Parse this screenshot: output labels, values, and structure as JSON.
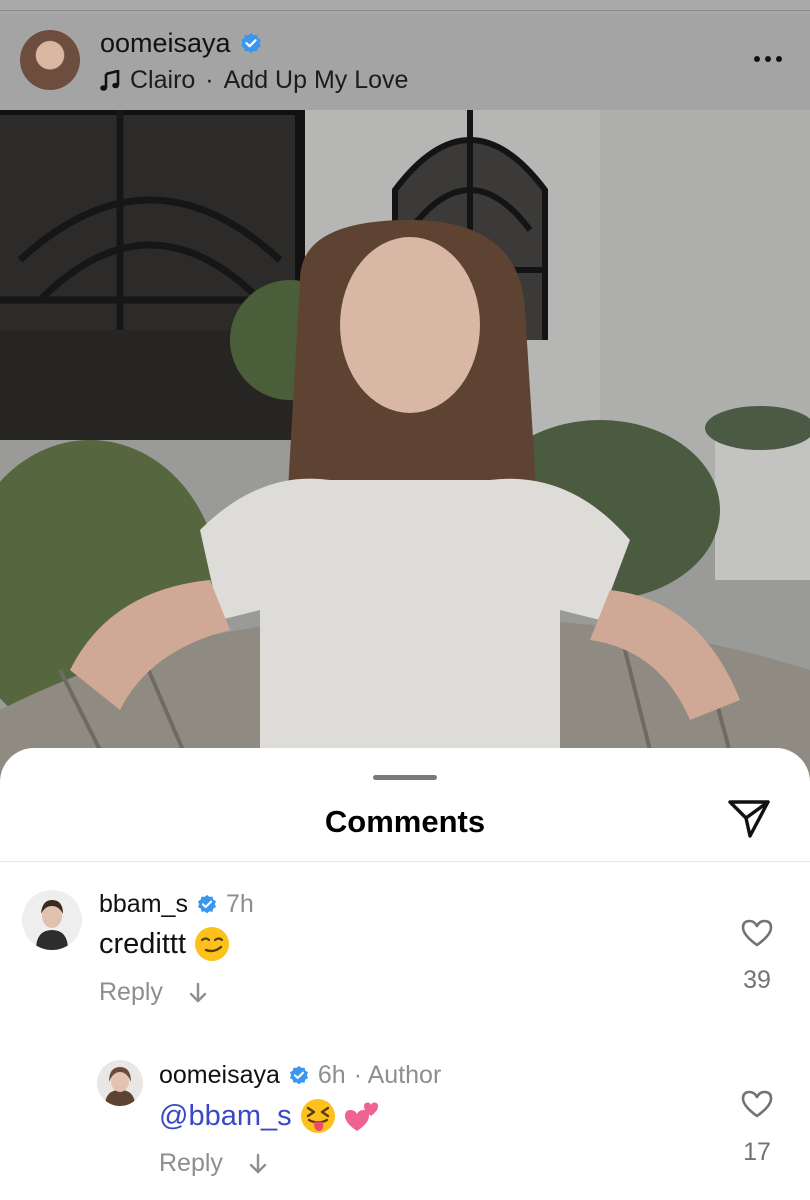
{
  "post": {
    "username": "oomeisaya",
    "music_artist": "Clairo",
    "music_separator": "·",
    "music_title": "Add Up My Love",
    "icons": {
      "music": "music-note-icon",
      "more": "more-options-icon",
      "verified": "verified-badge-icon"
    }
  },
  "sheet": {
    "title": "Comments",
    "share_icon": "send-icon"
  },
  "comments": [
    {
      "username": "bbam_s",
      "verified": true,
      "time": "7h",
      "text": "credittt",
      "emoji": "smirking-face",
      "reply_label": "Reply",
      "likes": "39"
    },
    {
      "username": "oomeisaya",
      "verified": true,
      "time": "6h",
      "author_label": "· Author",
      "mention": "@bbam_s",
      "emoji": [
        "squinting-face-with-tongue",
        "two-hearts"
      ],
      "reply_label": "Reply",
      "likes": "17"
    }
  ],
  "colors": {
    "verified": "#3897f0",
    "mention": "#3a48c8",
    "muted": "#8e8e8e"
  }
}
